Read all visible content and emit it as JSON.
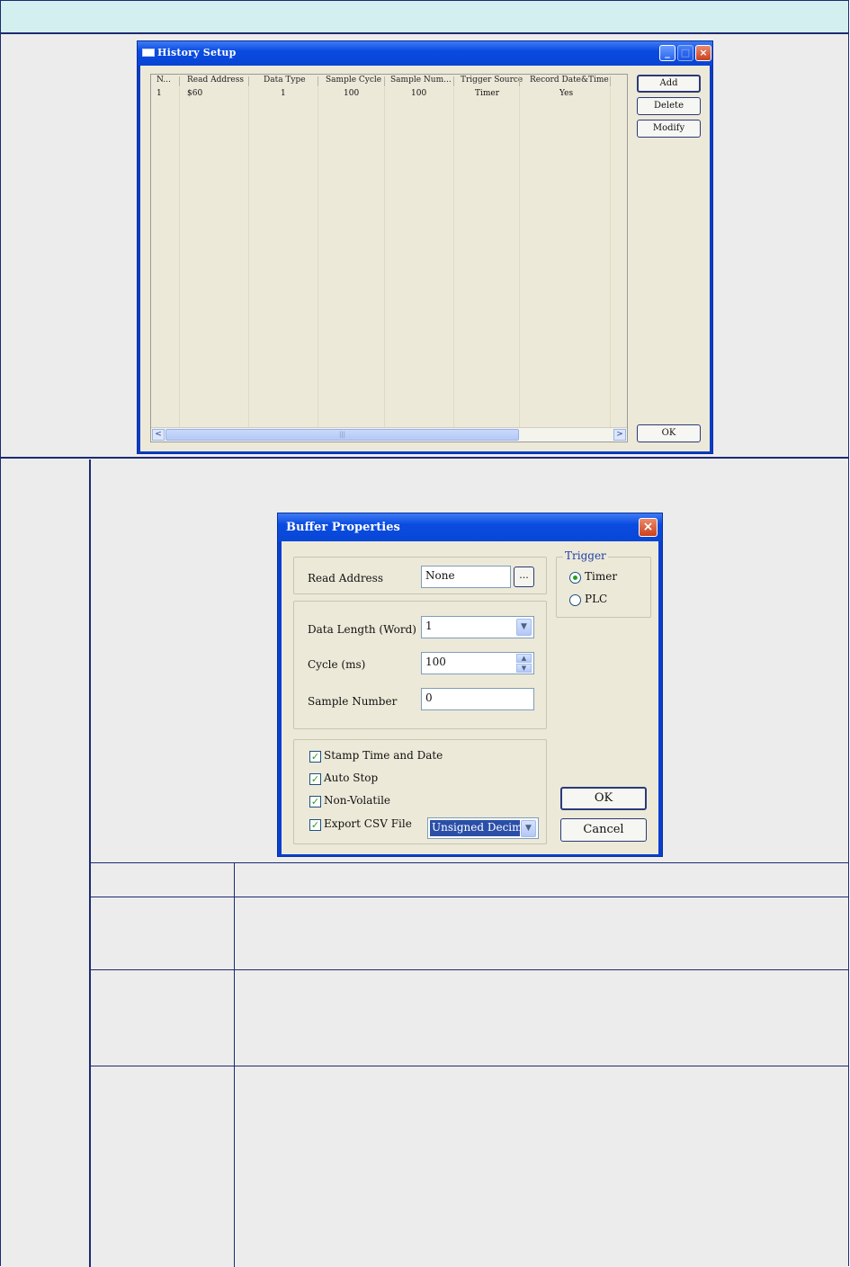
{
  "history_setup": {
    "title": "History Setup",
    "columns": [
      "N...",
      "Read Address",
      "Data Type",
      "Sample Cycle",
      "Sample Num...",
      "Trigger Source",
      "Record Date&Time"
    ],
    "rows": [
      {
        "n": "1",
        "read_address": "$60",
        "data_type": "1",
        "sample_cycle": "100",
        "sample_num": "100",
        "trigger_source": "Timer",
        "record_datetime": "Yes"
      }
    ],
    "buttons": {
      "add": "Add",
      "delete": "Delete",
      "modify": "Modify",
      "ok": "OK"
    },
    "scroll": {
      "left": "<",
      "right": ">",
      "grip": "|||"
    }
  },
  "buffer_properties": {
    "title": "Buffer Properties",
    "close_glyph": "×",
    "read_address_label": "Read Address",
    "read_address_value": "None",
    "browse_label": "...",
    "data_length_label": "Data Length (Word)",
    "data_length_value": "1",
    "cycle_label": "Cycle (ms)",
    "cycle_value": "100",
    "sample_number_label": "Sample Number",
    "sample_number_value": "0",
    "trigger": {
      "label": "Trigger",
      "options": [
        "Timer",
        "PLC"
      ],
      "selected": "Timer"
    },
    "options": [
      {
        "label": "Stamp Time and Date",
        "checked": true
      },
      {
        "label": "Auto Stop",
        "checked": true
      },
      {
        "label": "Non-Volatile",
        "checked": true
      },
      {
        "label": "Export CSV File",
        "checked": true
      }
    ],
    "csv_format_value": "Unsigned Decimal",
    "ok": "OK",
    "cancel": "Cancel"
  },
  "icons": {
    "check": "✓",
    "dropdown": "▼",
    "spin_up": "▲",
    "spin_down": "▼"
  }
}
